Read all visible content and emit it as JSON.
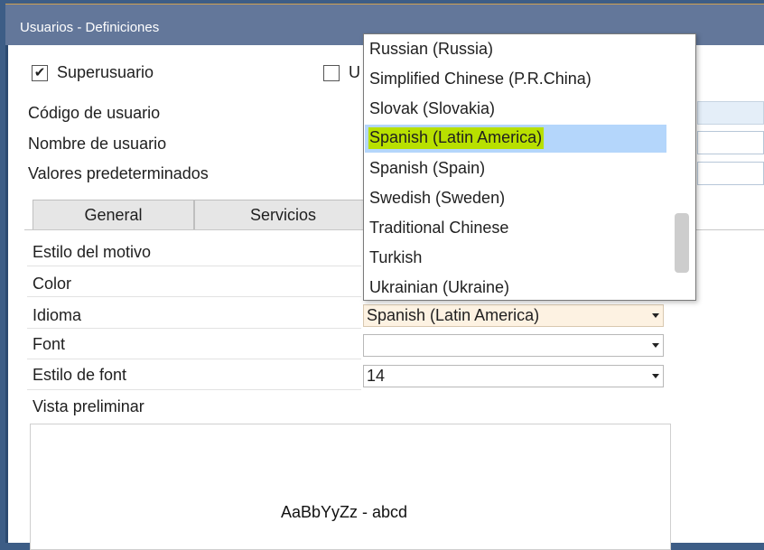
{
  "window": {
    "title": "Usuarios - Definiciones"
  },
  "checkboxes": [
    {
      "label": "Superusuario",
      "checked": true,
      "mnemonic": "r"
    },
    {
      "label": "U",
      "checked": false
    }
  ],
  "fields": [
    {
      "label": "Código de usuario",
      "value": ""
    },
    {
      "label": "Nombre de usuario",
      "value": ""
    },
    {
      "label": "Valores predeterminados",
      "value": ""
    }
  ],
  "tabs": [
    {
      "label": "General",
      "mnemonic": "G"
    },
    {
      "label": "Servicios",
      "mnemonic": "i"
    }
  ],
  "properties": [
    {
      "label": "Estilo del motivo",
      "value": ""
    },
    {
      "label": "Color",
      "value": ""
    },
    {
      "label": "Idioma",
      "value": "Spanish (Latin America)"
    },
    {
      "label": "Font",
      "value": ""
    },
    {
      "label": "Estilo de font",
      "value": "14"
    }
  ],
  "preview": {
    "label": "Vista preliminar",
    "sample_text": "AaBbYyZz - abcd"
  },
  "language_dropdown": {
    "options": [
      "Russian (Russia)",
      "Simplified Chinese (P.R.China)",
      "Slovak (Slovakia)",
      "Spanish (Latin America)",
      "Spanish (Spain)",
      "Swedish (Sweden)",
      "Traditional Chinese",
      "Turkish",
      "Ukrainian (Ukraine)"
    ],
    "selected": "Spanish (Latin America)"
  },
  "colors": {
    "title_bar": "#63779a",
    "desktop": "#3d5d86",
    "selection": "#b4d6fb",
    "highlight_marker": "#b8e000",
    "active_combo": "#fdf2e2"
  },
  "icons": {
    "combo_arrow": "chevron-down-icon",
    "check": "checkmark-icon"
  }
}
